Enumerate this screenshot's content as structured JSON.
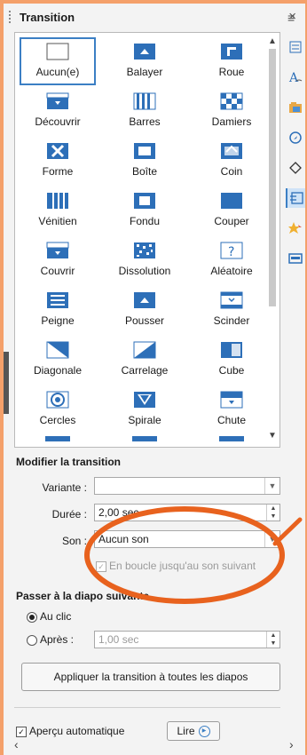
{
  "panel": {
    "title": "Transition",
    "close_glyph": "×",
    "menu_glyph": "≡"
  },
  "sidebar_icons": [
    "properties-icon",
    "styles-icon",
    "gallery-icon",
    "navigator-icon",
    "shapes-icon",
    "slide-transition-icon",
    "animation-icon",
    "master-slides-icon"
  ],
  "transitions": [
    {
      "label": "Aucun(e)",
      "icon": "none"
    },
    {
      "label": "Balayer",
      "icon": "wipe"
    },
    {
      "label": "Roue",
      "icon": "wheel"
    },
    {
      "label": "Découvrir",
      "icon": "uncover"
    },
    {
      "label": "Barres",
      "icon": "bars"
    },
    {
      "label": "Damiers",
      "icon": "checkers"
    },
    {
      "label": "Forme",
      "icon": "shape"
    },
    {
      "label": "Boîte",
      "icon": "box"
    },
    {
      "label": "Coin",
      "icon": "corner"
    },
    {
      "label": "Vénitien",
      "icon": "venetian"
    },
    {
      "label": "Fondu",
      "icon": "fade"
    },
    {
      "label": "Couper",
      "icon": "cut"
    },
    {
      "label": "Couvrir",
      "icon": "cover"
    },
    {
      "label": "Dissolution",
      "icon": "dissolve"
    },
    {
      "label": "Aléatoire",
      "icon": "random"
    },
    {
      "label": "Peigne",
      "icon": "comb"
    },
    {
      "label": "Pousser",
      "icon": "push"
    },
    {
      "label": "Scinder",
      "icon": "split"
    },
    {
      "label": "Diagonale",
      "icon": "diagonal"
    },
    {
      "label": "Carrelage",
      "icon": "tiles"
    },
    {
      "label": "Cube",
      "icon": "cube"
    },
    {
      "label": "Cercles",
      "icon": "circles"
    },
    {
      "label": "Spirale",
      "icon": "spiral"
    },
    {
      "label": "Chute",
      "icon": "fall"
    }
  ],
  "modify": {
    "heading": "Modifier la transition",
    "variant_label": "Variante :",
    "variant_value": "",
    "duration_label": "Durée :",
    "duration_value": "2,00 sec",
    "sound_label": "Son :",
    "sound_value": "Aucun son",
    "loop_label": "En boucle jusqu'au son suivant"
  },
  "advance": {
    "heading": "Passer à la diapo suivante",
    "on_click_label": "Au clic",
    "after_label": "Après :",
    "after_value": "1,00 sec"
  },
  "apply_all_label": "Appliquer la transition à toutes les diapos",
  "footer": {
    "auto_preview_label": "Aperçu automatique",
    "play_label": "Lire"
  },
  "annotation_color": "#E8621E",
  "accent_color": "#3B7FC4"
}
